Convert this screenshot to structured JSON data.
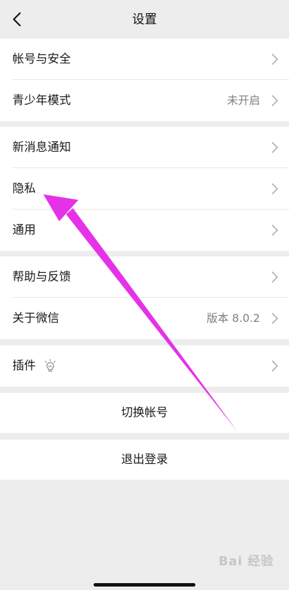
{
  "header": {
    "title": "设置",
    "back_icon": "chevron-left-icon"
  },
  "groups": [
    [
      {
        "label": "帐号与安全",
        "value": ""
      },
      {
        "label": "青少年模式",
        "value": "未开启"
      }
    ],
    [
      {
        "label": "新消息通知",
        "value": ""
      },
      {
        "label": "隐私",
        "value": ""
      },
      {
        "label": "通用",
        "value": ""
      }
    ],
    [
      {
        "label": "帮助与反馈",
        "value": ""
      },
      {
        "label": "关于微信",
        "value": "版本 8.0.2"
      }
    ],
    [
      {
        "label": "插件",
        "value": "",
        "icon": "lightbulb-icon"
      }
    ]
  ],
  "actions": {
    "switch_account": "切换帐号",
    "logout": "退出登录"
  },
  "colors": {
    "background": "#ededed",
    "card": "#ffffff",
    "annotation_arrow": "#e532e8"
  },
  "watermark": "Bai 经验"
}
